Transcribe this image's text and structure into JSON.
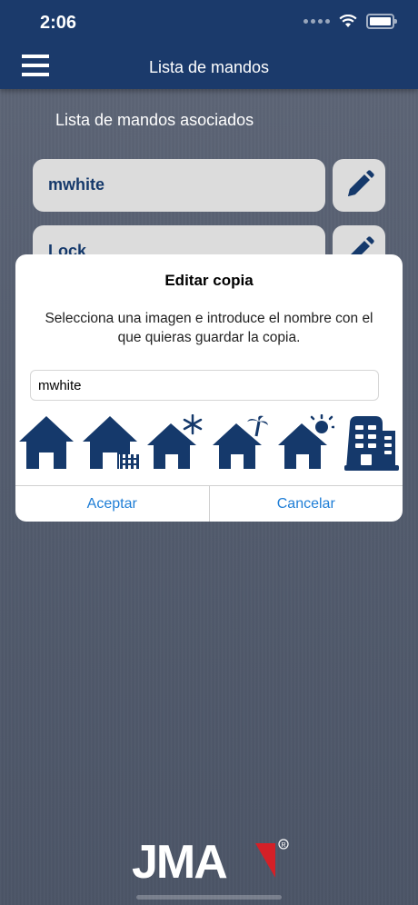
{
  "status_bar": {
    "time": "2:06"
  },
  "header": {
    "title": "Lista de mandos"
  },
  "section": {
    "title": "Lista de mandos asociados"
  },
  "items": [
    {
      "label": "mwhite"
    },
    {
      "label": "Lock"
    }
  ],
  "dialog": {
    "title": "Editar copia",
    "message": "Selecciona una imagen e introduce el nombre con el que quieras guardar la copia.",
    "input_value": "mwhite",
    "icons": [
      "house-icon",
      "house-fence-icon",
      "house-snow-icon",
      "house-palm-icon",
      "house-sun-icon",
      "building-icon"
    ],
    "accept_label": "Aceptar",
    "cancel_label": "Cancelar"
  },
  "colors": {
    "header": "#1b3a6b",
    "accent_link": "#1f7ed6",
    "icon_navy": "#15396b",
    "card": "#dcdcdc"
  },
  "logo": {
    "text": "JMA"
  }
}
